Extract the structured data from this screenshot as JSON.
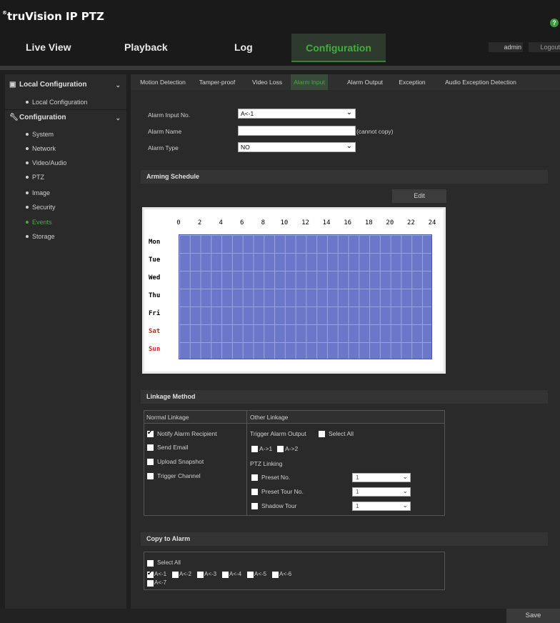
{
  "app": {
    "logo_text": "truVision  IP PTZ",
    "help_icon": "question-circle-icon"
  },
  "nav": {
    "tabs": [
      "Live View",
      "Playback",
      "Log",
      "Configuration"
    ],
    "active": "Configuration",
    "user": "admin",
    "logout": "Logout"
  },
  "sidebar": {
    "local_header": "Local Configuration",
    "local_items": [
      "Local Configuration"
    ],
    "config_header": "Configuration",
    "config_items": [
      "System",
      "Network",
      "Video/Audio",
      "PTZ",
      "Image",
      "Security",
      "Events",
      "Storage"
    ],
    "active_item": "Events"
  },
  "subtabs": [
    "Motion Detection",
    "Tamper-proof",
    "Video Loss",
    "Alarm Input",
    "Alarm Output",
    "Exception",
    "Audio Exception Detection"
  ],
  "active_subtab": "Alarm Input",
  "form": {
    "alarm_input_no_label": "Alarm Input No.",
    "alarm_input_no_value": "A<-1",
    "alarm_name_label": "Alarm Name",
    "alarm_name_value": "",
    "alarm_name_note": "(cannot copy)",
    "alarm_type_label": "Alarm Type",
    "alarm_type_value": "NO"
  },
  "arming": {
    "title": "Arming Schedule",
    "edit_label": "Edit",
    "hours": [
      "0",
      "2",
      "4",
      "6",
      "8",
      "10",
      "12",
      "14",
      "16",
      "18",
      "20",
      "22",
      "24"
    ],
    "days": [
      "Mon",
      "Tue",
      "Wed",
      "Thu",
      "Fri",
      "Sat",
      "Sun"
    ],
    "weekend_color": "#d02020",
    "schedule_fill_color": "#6b78c9"
  },
  "linkage": {
    "title": "Linkage Method",
    "normal_header": "Normal Linkage",
    "other_header": "Other Linkage",
    "normal_items": [
      {
        "label": "Notify Alarm Recipient",
        "checked": true
      },
      {
        "label": "Send Email",
        "checked": false
      },
      {
        "label": "Upload Snapshot",
        "checked": false
      },
      {
        "label": "Trigger Channel",
        "checked": false
      }
    ],
    "trigger_alarm_output_label": "Trigger Alarm Output",
    "select_all_label": "Select All",
    "outputs": [
      "A->1",
      "A->2"
    ],
    "ptz_linking_label": "PTZ Linking",
    "ptz_items": [
      {
        "label": "Preset No.",
        "value": "1"
      },
      {
        "label": "Preset Tour No.",
        "value": "1"
      },
      {
        "label": "Shadow Tour",
        "value": "1"
      }
    ]
  },
  "copy": {
    "title": "Copy to Alarm",
    "select_all_label": "Select All",
    "alarms": [
      {
        "label": "A<-1",
        "checked": true
      },
      {
        "label": "A<-2",
        "checked": false
      },
      {
        "label": "A<-3",
        "checked": false
      },
      {
        "label": "A<-4",
        "checked": false
      },
      {
        "label": "A<-5",
        "checked": false
      },
      {
        "label": "A<-6",
        "checked": false
      },
      {
        "label": "A<-7",
        "checked": false
      }
    ]
  },
  "footer": {
    "save_label": "Save"
  }
}
